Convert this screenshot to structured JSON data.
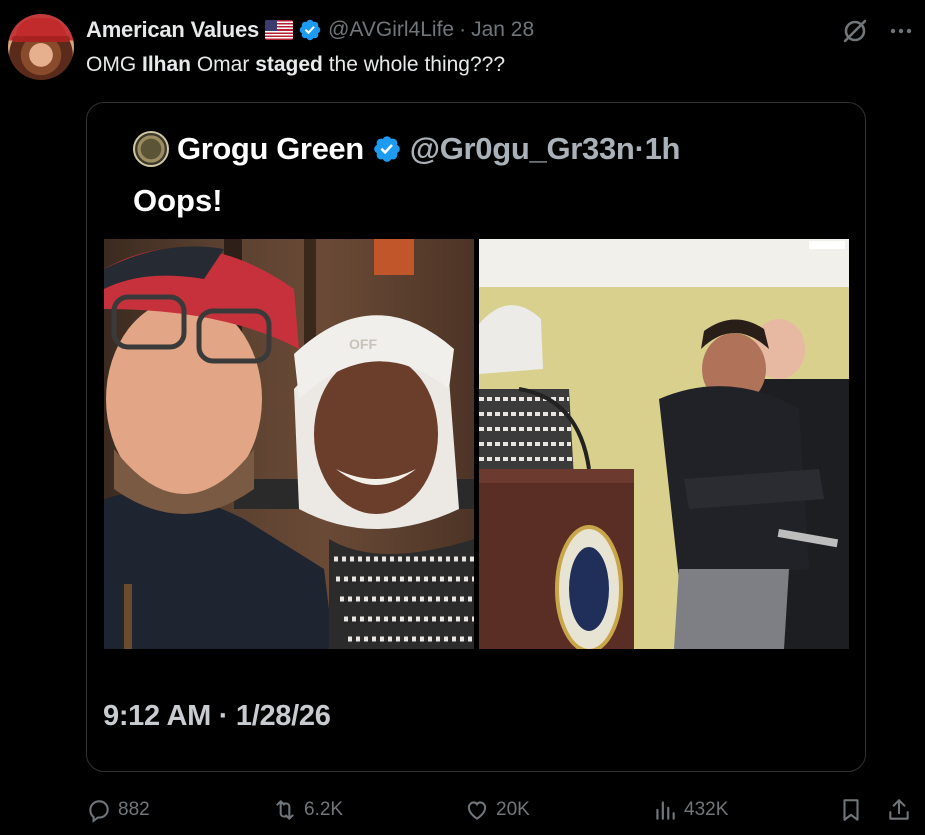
{
  "post": {
    "author": {
      "display_name": "American Values",
      "handle": "@AVGirl4Life",
      "separator": "·",
      "time": "Jan 28",
      "avatar_icon": "avatar",
      "verified_icon": "verified-badge-icon",
      "flag_icon": "us-flag-icon"
    },
    "text": {
      "part1": "OMG ",
      "bold1": "Ilhan",
      "part2": " Omar ",
      "bold2": "staged",
      "part3": " the whole thing???"
    },
    "media": {
      "quote_name": "Grogu Green",
      "quote_handle": "@Gr0gu_Gr33n",
      "quote_separator": "·",
      "quote_time": "1h",
      "quote_text": "Oops!",
      "photo_left_text": "OFF",
      "timestamp": "9:12 AM · 1/28/26"
    },
    "actions": {
      "replies": "882",
      "reposts": "6.2K",
      "likes": "20K",
      "views": "432K"
    }
  },
  "colors": {
    "background": "#000000",
    "text": "#e7e9ea",
    "muted": "#71767b",
    "verified": "#1d9bf0"
  }
}
